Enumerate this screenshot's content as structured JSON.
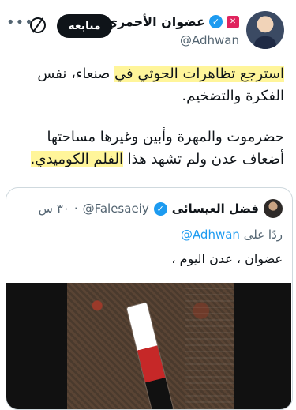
{
  "author": {
    "display_name": "عضوان الأحمري",
    "handle": "@Adhwan",
    "verified_mark": "✓",
    "badge_glyph": "✕",
    "follow_label": "متابعة",
    "more_glyph": "•••"
  },
  "tweet": {
    "line1_pre": "",
    "line1_hl": "استرجع تظاهرات الحوثي في",
    "line1_post": " صنعاء، نفس الفكرة والتضخيم.",
    "para2_pre": "حضرموت والمهرة وأبين وغيرها مساحتها أضعاف عدن ولم تشهد هذا ",
    "para2_hl": "الفلم الكوميدي."
  },
  "quote": {
    "display_name": "فضل العيسائى",
    "verified_mark": "✓",
    "handle": "@Falesaeiy",
    "separator": "·",
    "time": "٣٠ س",
    "reply_prefix": "ردًا على",
    "reply_handle": "@Adhwan",
    "text": "عضوان ، عدن اليوم ،"
  },
  "icons": {
    "verified": "verified-badge-icon",
    "grok": "grok-icon",
    "more": "more-options-icon"
  },
  "colors": {
    "highlight": "#fff59a",
    "verified": "#1d9bf0",
    "follow_button": "#0f1419"
  }
}
